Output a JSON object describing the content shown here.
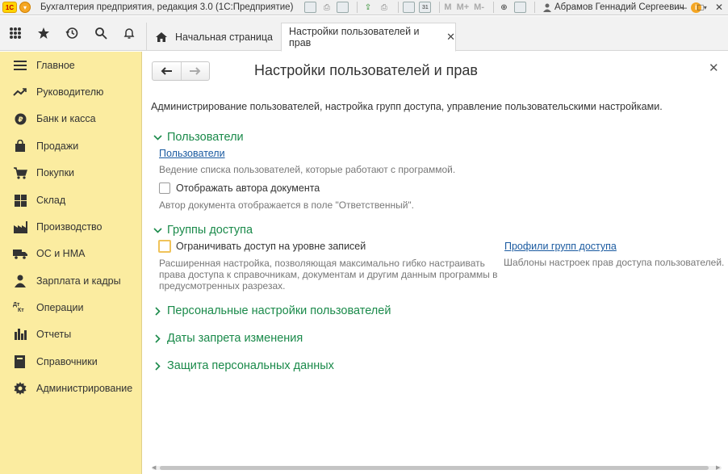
{
  "titlebar": {
    "app_logo": "1С",
    "app_title": "Бухгалтерия предприятия, редакция 3.0  (1С:Предприятие)",
    "toolbar_m_labels": [
      "M",
      "M+",
      "M-"
    ],
    "calendar_day": "31",
    "user_name": "Абрамов Геннадий Сергеевич",
    "info_label": "i"
  },
  "tabs": {
    "home_label": "Начальная страница",
    "active_label": "Настройки пользователей и прав"
  },
  "sidebar": {
    "items": [
      {
        "label": "Главное",
        "icon": "menu-lines-icon"
      },
      {
        "label": "Руководителю",
        "icon": "trend-chart-icon"
      },
      {
        "label": "Банк и касса",
        "icon": "coin-icon"
      },
      {
        "label": "Продажи",
        "icon": "shopping-bag-icon"
      },
      {
        "label": "Покупки",
        "icon": "cart-icon"
      },
      {
        "label": "Склад",
        "icon": "warehouse-grid-icon"
      },
      {
        "label": "Производство",
        "icon": "factory-icon"
      },
      {
        "label": "ОС и НМА",
        "icon": "truck-icon"
      },
      {
        "label": "Зарплата и кадры",
        "icon": "person-icon"
      },
      {
        "label": "Операции",
        "icon": "dt-kt-icon"
      },
      {
        "label": "Отчеты",
        "icon": "bar-chart-icon"
      },
      {
        "label": "Справочники",
        "icon": "book-icon"
      },
      {
        "label": "Администрирование",
        "icon": "gear-icon"
      }
    ],
    "dt_kt_top": "Дт",
    "dt_kt_bottom": "Кт"
  },
  "form": {
    "title": "Настройки пользователей и прав",
    "description": "Администрирование пользователей, настройка групп доступа, управление пользовательскими настройками.",
    "users": {
      "group_title": "Пользователи",
      "link": "Пользователи",
      "link_hint": "Ведение списка пользователей, которые работают с программой.",
      "checkbox_label": "Отображать автора документа",
      "checkbox_checked": false,
      "checkbox_hint": "Автор документа отображается в поле \"Ответственный\"."
    },
    "access_groups": {
      "group_title": "Группы доступа",
      "checkbox_label": "Ограничивать доступ на уровне записей",
      "checkbox_checked": false,
      "checkbox_hint": "Расширенная настройка, позволяющая максимально гибко настраивать права доступа к справочникам, документам и другим данным программы в предусмотренных разрезах.",
      "profiles_link": "Профили групп доступа",
      "profiles_hint": "Шаблоны настроек прав доступа пользователей."
    },
    "collapsed_groups": [
      "Персональные настройки пользователей",
      "Даты запрета изменения",
      "Защита персональных данных"
    ]
  },
  "colors": {
    "sidebar_bg": "#fbeca0",
    "group_title": "#1a8a4a",
    "link": "#1a5aa0",
    "hint": "#777777"
  }
}
